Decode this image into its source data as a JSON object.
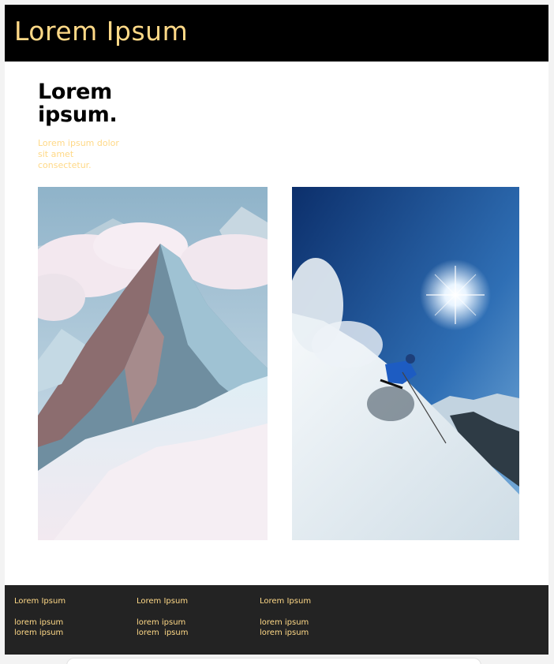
{
  "colors": {
    "accent": "#ffd987",
    "header_bg": "#000000",
    "footer_bg": "#232323",
    "page_bg": "#ffffff"
  },
  "header": {
    "title": "Lorem Ipsum"
  },
  "hero": {
    "heading": "Lorem ipsum.",
    "subtext": "Lorem ipsum dolor sit amet consectetur."
  },
  "gallery": {
    "images": [
      {
        "name": "snowy-mountain-peak-photo"
      },
      {
        "name": "skier-descending-slope-photo"
      }
    ]
  },
  "footer": {
    "columns": [
      {
        "title": "Lorem Ipsum",
        "links": [
          "lorem ipsum",
          "lorem ipsum"
        ]
      },
      {
        "title": "Lorem Ipsum",
        "links": [
          "lorem ipsum",
          "lorem  ipsum"
        ]
      },
      {
        "title": "Lorem Ipsum",
        "links": [
          "lorem ipsum",
          "lorem ipsum"
        ]
      }
    ]
  }
}
